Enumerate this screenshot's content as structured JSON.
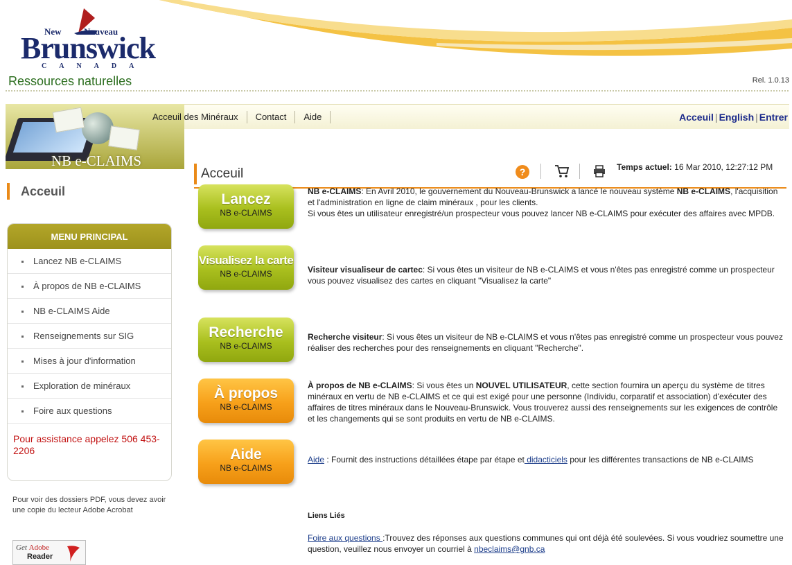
{
  "header": {
    "logo_new": "New",
    "logo_nouveau": "Nouveau",
    "logo_brunswick": "Brunswick",
    "logo_canada": "CANADA",
    "department": "Ressources naturelles",
    "release": "Rel. 1.0.13"
  },
  "banner": {
    "title": "NB e-CLAIMS"
  },
  "topnav": {
    "items": [
      "Acceuil des Minéraux",
      "Contact",
      "Aide"
    ]
  },
  "rightnav": {
    "home": "Acceuil",
    "english": "English",
    "enter": "Entrer",
    "separator": "|"
  },
  "sidebar": {
    "heading": "Acceuil",
    "menu_title": "MENU PRINCIPAL",
    "items": [
      "Lancez NB e-CLAIMS",
      "À propos de NB e-CLAIMS",
      "NB e-CLAIMS Aide",
      "Renseignements sur SIG",
      "Mises à jour d'information",
      "Exploration de minéraux",
      "Foire aux questions"
    ],
    "assistance": "Pour assistance appelez 506 453-2206",
    "pdf_note": "Pour voir des dossiers PDF, vous devez avoir une copie du lecteur Adobe Acrobat",
    "adobe_get": "Get",
    "adobe_brand": "Adobe",
    "adobe_reader": "Reader"
  },
  "main": {
    "title": "Acceuil",
    "time_label": "Temps actuel:",
    "time_value": "16 Mar 2010, 12:27:12 PM",
    "help_glyph": "?",
    "icons": [
      "help-icon",
      "cart-icon",
      "print-icon"
    ]
  },
  "actions": [
    {
      "big": "Lancez",
      "small": "NB e-CLAIMS",
      "color": "green",
      "desc_bold": "NB e-CLAIMS",
      "desc_1": ": En Avril 2010, le gouvernement du Nouveau-Brunswick a lancé le nouveau système ",
      "desc_bold2": "NB e-CLAIMS",
      "desc_2": ", l'acquisition et l'administration en ligne de claim minéraux , pour les clients.",
      "desc_3": "Si vous êtes un utilisateur enregistré/un prospecteur vous pouvez lancer NB e-CLAIMS pour exécuter des affaires avec MPDB."
    },
    {
      "big": "Visualisez la carte",
      "small": "NB e-CLAIMS",
      "color": "green",
      "desc_bold": "Visiteur visualiseur de cartec",
      "desc_1": ": Si vous êtes un visiteur de NB e-CLAIMS et vous n'êtes pas enregistré comme un prospecteur vous pouvez visualisez des cartes en cliquant \"Visualisez la carte\""
    },
    {
      "big": "Recherche",
      "small": "NB e-CLAIMS",
      "color": "green",
      "desc_bold": "Recherche visiteur",
      "desc_1": ": Si vous êtes un visiteur de NB e-CLAIMS et vous n'êtes pas enregistré comme un prospecteur vous pouvez réaliser des recherches pour des renseignements en cliquant \"Recherche\"."
    },
    {
      "big": "À propos",
      "small": "NB e-CLAIMS",
      "color": "orange",
      "desc_bold": "À propos de NB e-CLAIMS",
      "desc_1": ": Si vous êtes un ",
      "desc_bold2": "NOUVEL UTILISATEUR",
      "desc_2": ", cette section fournira un aperçu du système de titres minéraux en vertu de NB e-CLAIMS et ce qui est exigé pour une personne (Individu, corparatif et association) d'exécuter des affaires de titres minéraux dans le Nouveau-Brunswick.  Vous trouverez aussi des renseignements sur les exigences de contrôle et les changements qui se sont produits en vertu de NB e-CLAIMS."
    },
    {
      "big": "Aide",
      "small": "NB e-CLAIMS",
      "color": "orange",
      "link": "Aide",
      "desc_1": " : Fournit des instructions détaillées étape par étape et",
      "link2": " didacticiels",
      "desc_2": " pour les différentes transactions de NB e-CLAIMS"
    }
  ],
  "related": {
    "title": "Liens Liés",
    "faq_link": "Foire aux questions ",
    "faq_text": ":Trouvez des réponses aux questions communes qui ont déjà été soulevées. Si vous voudriez soumettre une question, veuillez nous envoyer un courriel à ",
    "email": "nbeclaims@gnb.ca"
  },
  "colors": {
    "accent_orange": "#ea8a18",
    "menu_olive": "#a69a22",
    "button_green": "#a9bf1e",
    "button_orange": "#f7a01a",
    "link_blue": "#1b2a8b",
    "assist_red": "#c21212",
    "dept_green": "#2c6e1f"
  }
}
